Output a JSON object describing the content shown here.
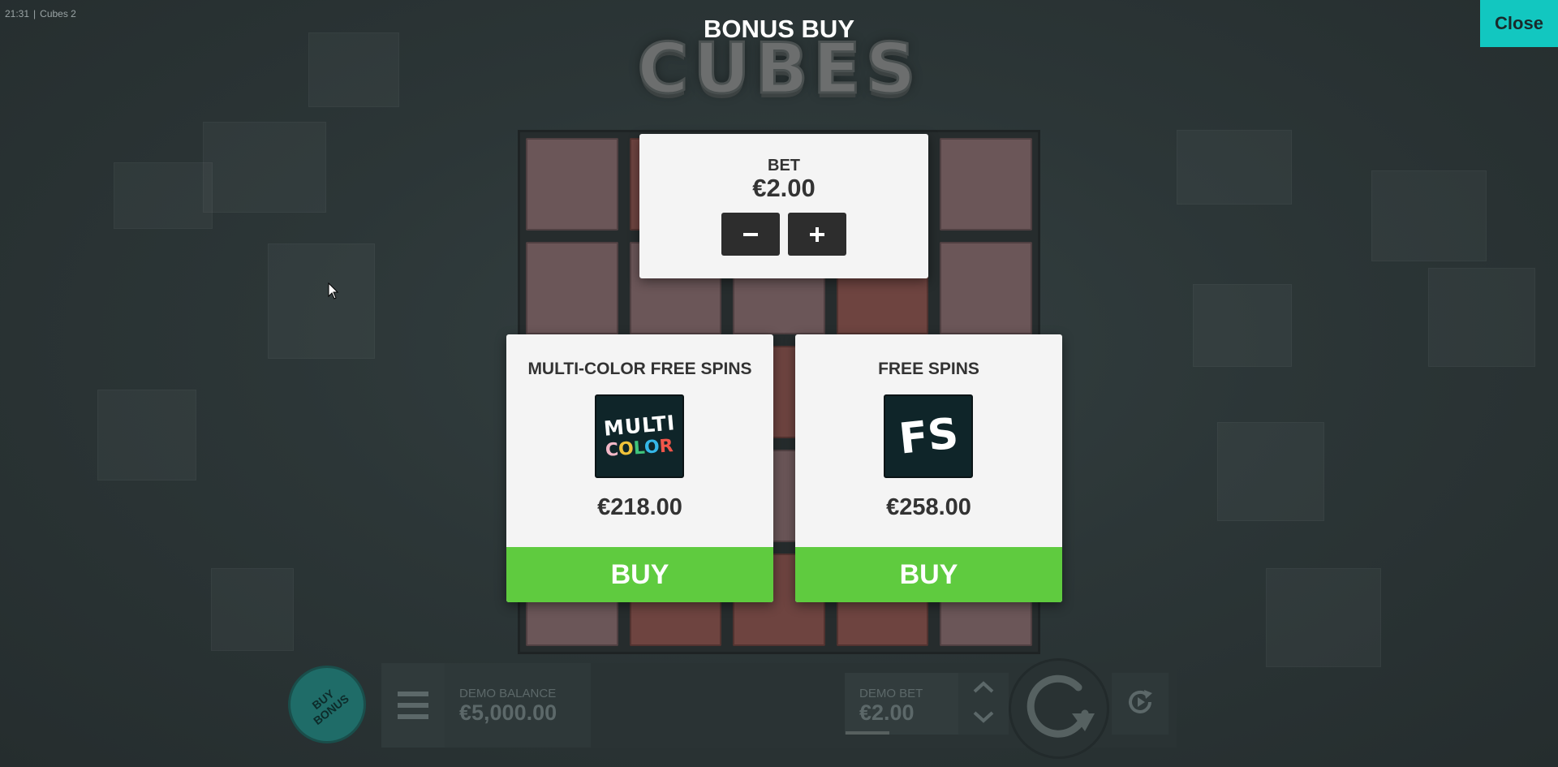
{
  "status_bar": {
    "time": "21:31",
    "separator": "|",
    "game_name": "Cubes 2"
  },
  "logo": {
    "text": "CUBES"
  },
  "modal": {
    "title": "BONUS BUY",
    "close_label": "Close",
    "bet": {
      "label": "BET",
      "value": "€2.00",
      "decrease_icon": "minus-icon",
      "increase_icon": "plus-icon"
    },
    "offers": [
      {
        "title": "MULTI-COLOR FREE SPINS",
        "icon_text_top": "MULTI",
        "icon_text_bottom": "COLOR",
        "price": "€218.00",
        "buy_label": "BUY"
      },
      {
        "title": "FREE SPINS",
        "icon_text": "FS",
        "price": "€258.00",
        "buy_label": "BUY"
      }
    ]
  },
  "bottom_bar": {
    "buy_bonus_label": "BUY BONUS",
    "menu_icon": "hamburger-menu-icon",
    "balance_label": "DEMO BALANCE",
    "balance_value": "€5,000.00",
    "bet_label": "DEMO BET",
    "bet_value": "€2.00",
    "bet_up_icon": "chevron-up-icon",
    "bet_down_icon": "chevron-down-icon",
    "spin_icon": "spin-arrow-icon",
    "autoplay_icon": "autoplay-icon"
  },
  "colors": {
    "background": "#2b3435",
    "close_button": "#12c7c0",
    "buy_button": "#5fcb3f",
    "panel": "#f4f4f4",
    "offer_icon_bg": "#0f2529",
    "buy_bonus_button": "#1f6c68"
  }
}
